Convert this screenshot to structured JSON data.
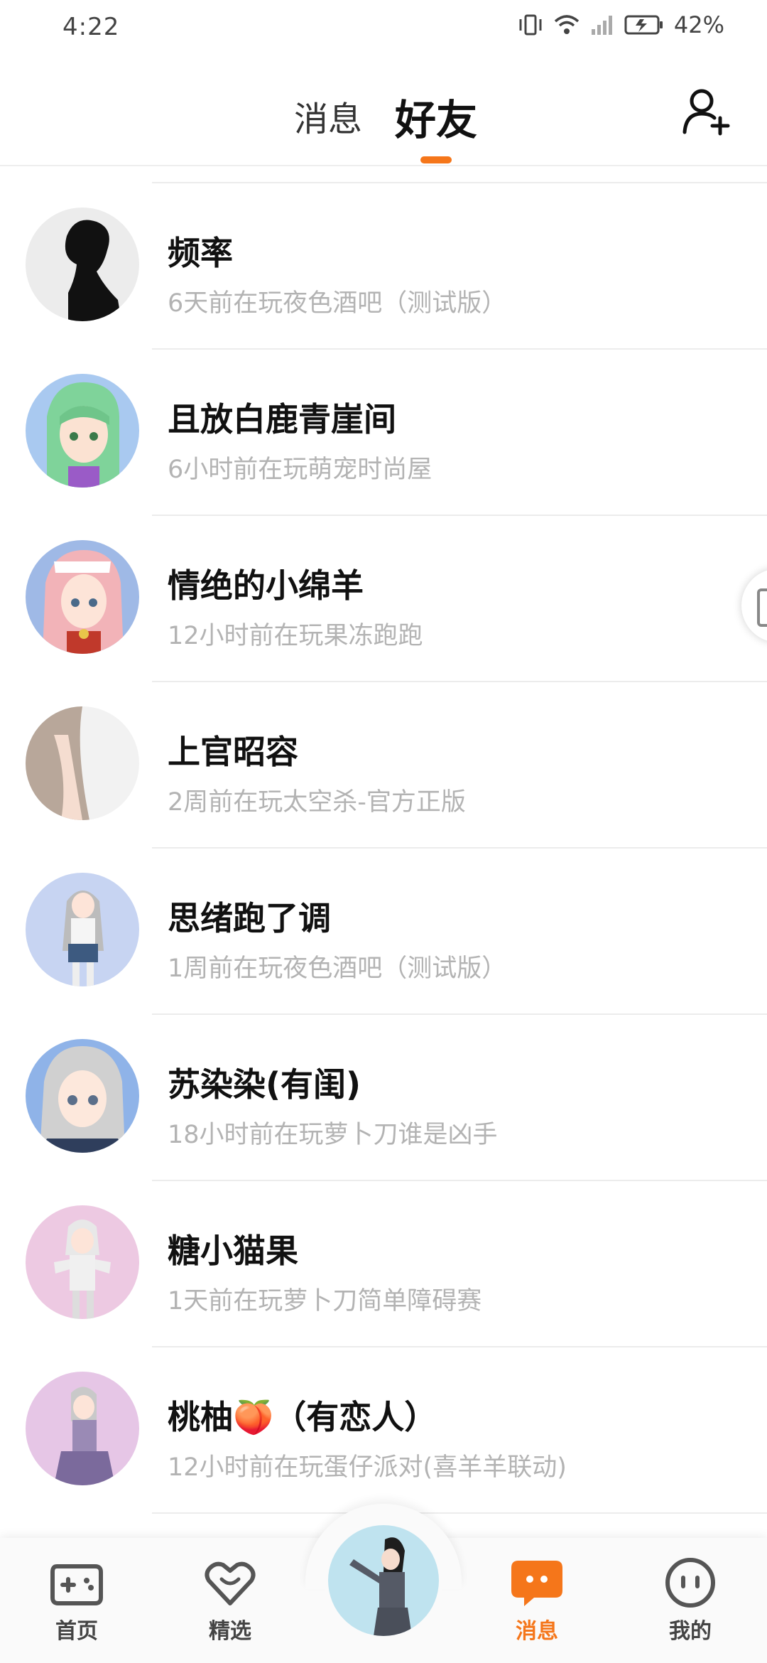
{
  "status_bar": {
    "time": "4:22",
    "battery": "42%"
  },
  "header": {
    "tabs": [
      {
        "label": "消息",
        "active": false
      },
      {
        "label": "好友",
        "active": true
      }
    ],
    "accent_color": "#f5761a",
    "add_friend_icon": "add-user-icon"
  },
  "friends": [
    {
      "name": "频率",
      "status": "6天前在玩夜色酒吧（测试版）"
    },
    {
      "name": "且放白鹿青崖间",
      "status": "6小时前在玩萌宠时尚屋"
    },
    {
      "name": "情绝的小绵羊",
      "status": "12小时前在玩果冻跑跑"
    },
    {
      "name": "上官昭容",
      "status": "2周前在玩太空杀-官方正版"
    },
    {
      "name": "思绪跑了调",
      "status": "1周前在玩夜色酒吧（测试版）"
    },
    {
      "name": "苏染染(有闺)",
      "status": "18小时前在玩萝卜刀谁是凶手"
    },
    {
      "name": "糖小猫果",
      "status": "1天前在玩萝卜刀简单障碍赛"
    },
    {
      "name": "桃柚🍑（有恋人）",
      "status": "12小时前在玩蛋仔派对(喜羊羊联动)"
    }
  ],
  "bottom_nav": [
    {
      "label": "首页",
      "icon": "gamepad-icon",
      "active": false
    },
    {
      "label": "精选",
      "icon": "heart-gem-icon",
      "active": false
    },
    {
      "label": "消息",
      "icon": "chat-bubble-icon",
      "active": true
    },
    {
      "label": "我的",
      "icon": "face-icon",
      "active": false
    }
  ]
}
